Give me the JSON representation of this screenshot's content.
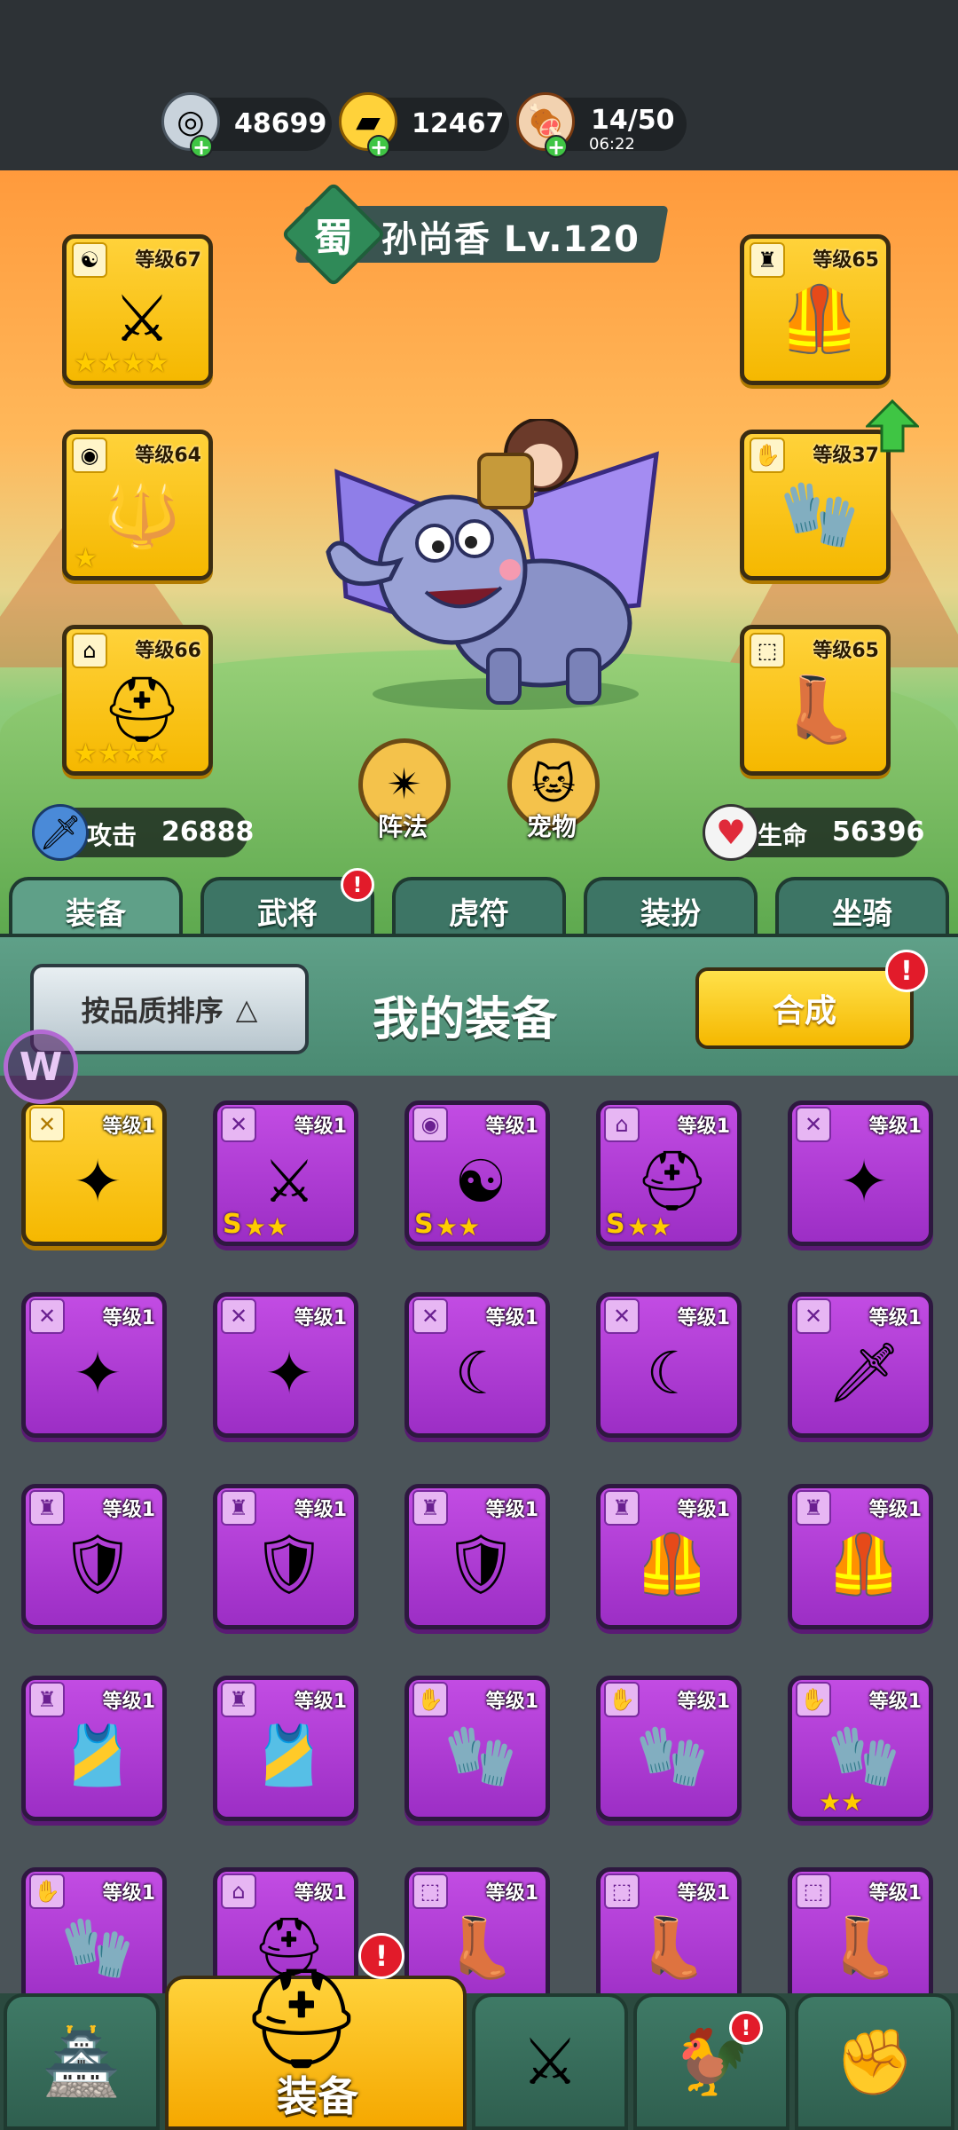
{
  "resources": [
    {
      "name": "silver",
      "icon": "silver-coin-icon",
      "value": "48699"
    },
    {
      "name": "gold",
      "icon": "gold-ingot-icon",
      "value": "12467"
    },
    {
      "name": "stamina",
      "icon": "meat-icon",
      "value": "14/50",
      "timer": "06:22"
    }
  ],
  "hero": {
    "kingdom": "蜀",
    "name": "孙尚香 Lv.120",
    "attack_label": "攻击",
    "attack_value": "26888",
    "hp_label": "生命",
    "hp_value": "56396",
    "formation_label": "阵法",
    "pet_label": "宠物"
  },
  "equipped": {
    "left": [
      {
        "level": "等级67",
        "stars": "★★★★",
        "icon": "yin-yang-icon"
      },
      {
        "level": "等级64",
        "stars": "★",
        "icon": "medal-icon"
      },
      {
        "level": "等级66",
        "stars": "★★★★",
        "icon": "helmet-icon"
      }
    ],
    "right": [
      {
        "level": "等级65",
        "stars": "",
        "icon": "armor-icon"
      },
      {
        "level": "等级37",
        "stars": "",
        "icon": "gauntlet-icon"
      },
      {
        "level": "等级65",
        "stars": "",
        "icon": "boot-icon"
      }
    ]
  },
  "tabs": [
    {
      "label": "装备",
      "active": true
    },
    {
      "label": "武将",
      "badge": "!"
    },
    {
      "label": "虎符"
    },
    {
      "label": "装扮"
    },
    {
      "label": "坐骑"
    }
  ],
  "panel": {
    "sort_label": "按品质排序",
    "title": "我的装备",
    "merge_label": "合成",
    "merge_badge": "!"
  },
  "items": [
    {
      "level": "等级1",
      "quality": "gold",
      "art": "✦",
      "cat": "✕"
    },
    {
      "level": "等级1",
      "quality": "purple",
      "art": "⚔",
      "cat": "✕",
      "grade": "S",
      "stars": "★★"
    },
    {
      "level": "等级1",
      "quality": "purple",
      "art": "☯",
      "cat": "◉",
      "grade": "S",
      "stars": "★★"
    },
    {
      "level": "等级1",
      "quality": "purple",
      "art": "⛑",
      "cat": "⌂",
      "grade": "S",
      "stars": "★★"
    },
    {
      "level": "等级1",
      "quality": "purple",
      "art": "✦",
      "cat": "✕"
    },
    {
      "level": "等级1",
      "quality": "purple",
      "art": "✦",
      "cat": "✕"
    },
    {
      "level": "等级1",
      "quality": "purple",
      "art": "✦",
      "cat": "✕"
    },
    {
      "level": "等级1",
      "quality": "purple",
      "art": "☾",
      "cat": "✕"
    },
    {
      "level": "等级1",
      "quality": "purple",
      "art": "☾",
      "cat": "✕"
    },
    {
      "level": "等级1",
      "quality": "purple",
      "art": "🗡",
      "cat": "✕"
    },
    {
      "level": "等级1",
      "quality": "purple",
      "art": "🛡",
      "cat": "♜"
    },
    {
      "level": "等级1",
      "quality": "purple",
      "art": "🛡",
      "cat": "♜"
    },
    {
      "level": "等级1",
      "quality": "purple",
      "art": "🛡",
      "cat": "♜"
    },
    {
      "level": "等级1",
      "quality": "purple",
      "art": "🦺",
      "cat": "♜"
    },
    {
      "level": "等级1",
      "quality": "purple",
      "art": "🦺",
      "cat": "♜"
    },
    {
      "level": "等级1",
      "quality": "purple",
      "art": "🎽",
      "cat": "♜"
    },
    {
      "level": "等级1",
      "quality": "purple",
      "art": "🎽",
      "cat": "♜"
    },
    {
      "level": "等级1",
      "quality": "purple",
      "art": "🧤",
      "cat": "✋"
    },
    {
      "level": "等级1",
      "quality": "purple",
      "art": "🧤",
      "cat": "✋"
    },
    {
      "level": "等级1",
      "quality": "purple",
      "art": "🧤",
      "cat": "✋",
      "stars": "★★"
    },
    {
      "level": "等级1",
      "quality": "purple",
      "art": "🧤",
      "cat": "✋"
    },
    {
      "level": "等级1",
      "quality": "purple",
      "art": "⛑",
      "cat": "⌂"
    },
    {
      "level": "等级1",
      "quality": "purple",
      "art": "👢",
      "cat": "⬚"
    },
    {
      "level": "等级1",
      "quality": "purple",
      "art": "👢",
      "cat": "⬚"
    },
    {
      "level": "等级1",
      "quality": "purple",
      "art": "👢",
      "cat": "⬚"
    }
  ],
  "bottom_nav": [
    {
      "icon": "castle-gate-icon"
    },
    {
      "icon": "helmet-icon",
      "label": "装备",
      "active": true,
      "badge": "!"
    },
    {
      "icon": "crossed-swords-icon"
    },
    {
      "icon": "rooster-icon",
      "badge": "!"
    },
    {
      "icon": "fist-upgrade-icon"
    }
  ],
  "watermark": "W",
  "colors": {
    "gold": "#f5b800",
    "purple": "#b23fd6",
    "green_tab": "#4a8a72",
    "badge_red": "#e21b2a"
  }
}
